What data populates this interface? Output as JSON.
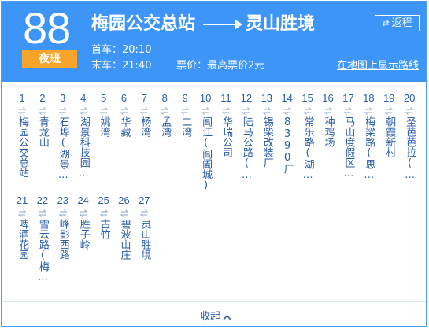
{
  "route": {
    "number": "88",
    "badge": "夜班",
    "origin": "梅园公交总站",
    "destination": "灵山胜境",
    "return_label": "返程",
    "first_bus": "首车：20:10",
    "last_bus": "末车：21:40",
    "fare": "票价：最高票价2元",
    "map_link": "在地图上显示路线"
  },
  "stops": [
    {
      "num": "1",
      "name": "梅园公交总站"
    },
    {
      "num": "2",
      "name": "青龙山"
    },
    {
      "num": "3",
      "name": "石埠(湖景…"
    },
    {
      "num": "4",
      "name": "湖景科技园…"
    },
    {
      "num": "5",
      "name": "姚湾"
    },
    {
      "num": "6",
      "name": "华藏"
    },
    {
      "num": "7",
      "name": "杨湾"
    },
    {
      "num": "8",
      "name": "孟湾"
    },
    {
      "num": "9",
      "name": "二湾"
    },
    {
      "num": "10",
      "name": "阊江(阊阖城)"
    },
    {
      "num": "11",
      "name": "华瑞公司"
    },
    {
      "num": "12",
      "name": "陆马公路(…"
    },
    {
      "num": "13",
      "name": "锡柴改装厂"
    },
    {
      "num": "14",
      "name": "8390厂"
    },
    {
      "num": "15",
      "name": "常乐路(湖…"
    },
    {
      "num": "16",
      "name": "种鸡场"
    },
    {
      "num": "17",
      "name": "马山度假区…"
    },
    {
      "num": "18",
      "name": "梅梁路(思…"
    },
    {
      "num": "19",
      "name": "朝霞新村"
    },
    {
      "num": "20",
      "name": "圣芭芭拉(…"
    },
    {
      "num": "21",
      "name": "啤酒花园"
    },
    {
      "num": "22",
      "name": "雪云路(梅…"
    },
    {
      "num": "23",
      "name": "峰影西路"
    },
    {
      "num": "24",
      "name": "胜子岭"
    },
    {
      "num": "25",
      "name": "古竹"
    },
    {
      "num": "26",
      "name": "碧波山庄"
    },
    {
      "num": "27",
      "name": "灵山胜境"
    }
  ],
  "footer": {
    "collapse_label": "收起"
  },
  "colors": {
    "header_bg": "#3e95f8",
    "badge_bg": "#f7a52a",
    "stop_text": "#2a5ea8"
  }
}
